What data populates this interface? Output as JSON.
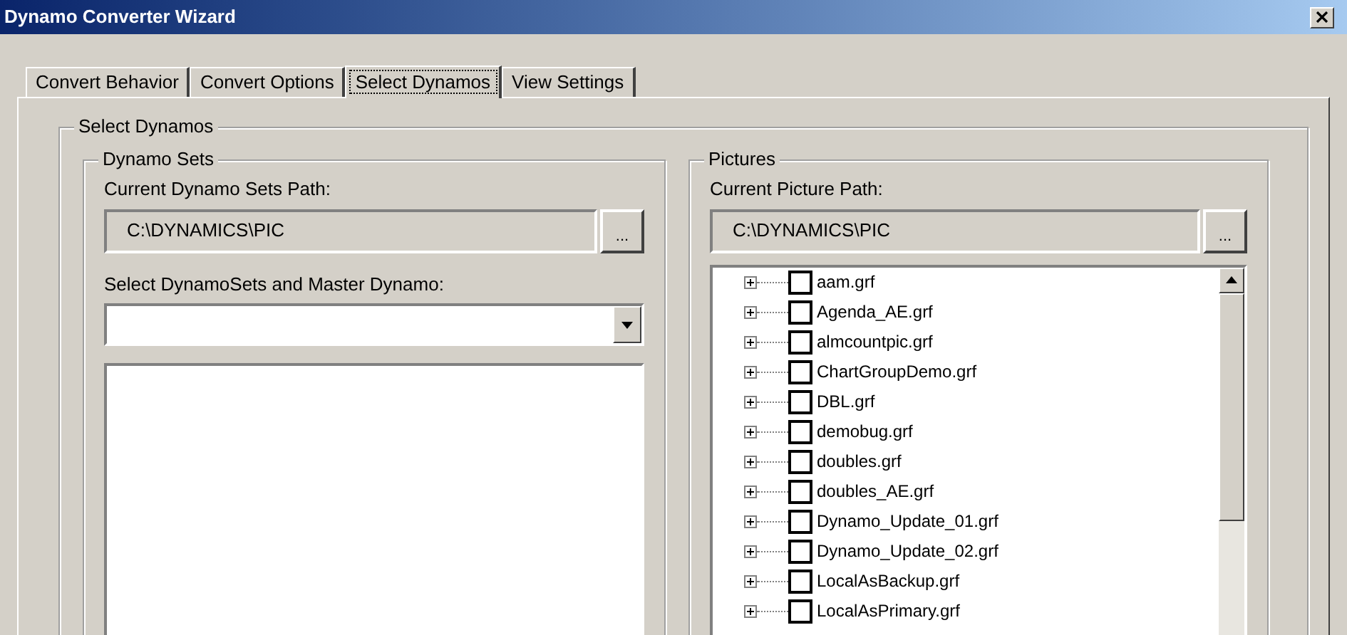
{
  "window": {
    "title": "Dynamo Converter Wizard"
  },
  "tabs": [
    {
      "label": "Convert Behavior",
      "selected": false
    },
    {
      "label": "Convert Options",
      "selected": false
    },
    {
      "label": "Select Dynamos",
      "selected": true
    },
    {
      "label": "View Settings",
      "selected": false
    }
  ],
  "select_dynamos": {
    "title": "Select Dynamos",
    "dynamo_sets": {
      "title": "Dynamo Sets",
      "path_label": "Current Dynamo Sets Path:",
      "path_value": "C:\\DYNAMICS\\PIC",
      "browse_button": "...",
      "select_label": "Select DynamoSets and Master Dynamo:"
    },
    "pictures": {
      "title": "Pictures",
      "path_label": "Current Picture Path:",
      "path_value": "C:\\DYNAMICS\\PIC",
      "browse_button": "...",
      "files": [
        {
          "name": "aam.grf",
          "checked": false
        },
        {
          "name": "Agenda_AE.grf",
          "checked": false
        },
        {
          "name": "almcountpic.grf",
          "checked": false
        },
        {
          "name": "ChartGroupDemo.grf",
          "checked": false
        },
        {
          "name": "DBL.grf",
          "checked": false
        },
        {
          "name": "demobug.grf",
          "checked": false
        },
        {
          "name": "doubles.grf",
          "checked": false
        },
        {
          "name": "doubles_AE.grf",
          "checked": false
        },
        {
          "name": "Dynamo_Update_01.grf",
          "checked": false
        },
        {
          "name": "Dynamo_Update_02.grf",
          "checked": false
        },
        {
          "name": "LocalAsBackup.grf",
          "checked": false
        },
        {
          "name": "LocalAsPrimary.grf",
          "checked": false
        }
      ]
    }
  }
}
